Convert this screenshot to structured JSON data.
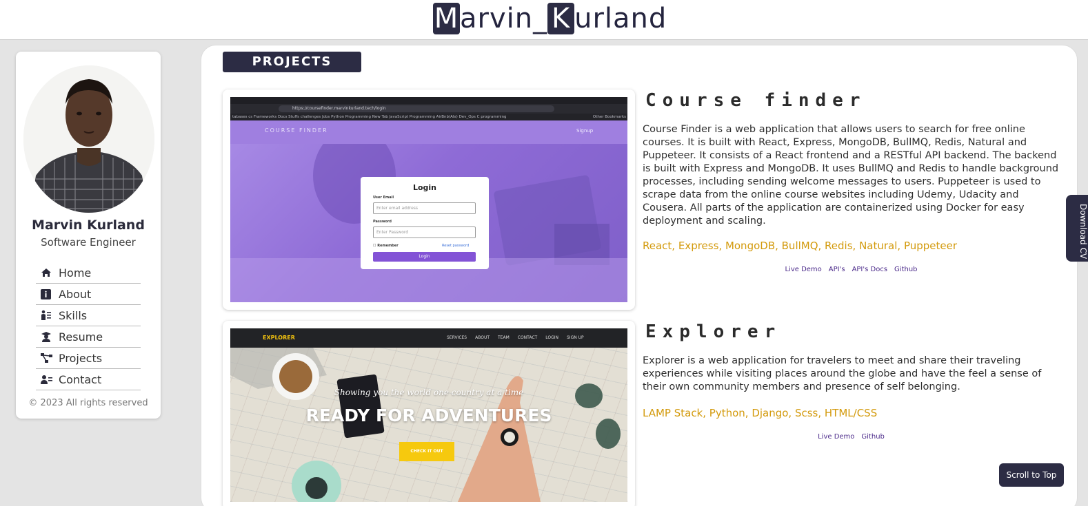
{
  "header": {
    "brand_initial_first": "M",
    "brand_rest_first": "arvin_",
    "brand_initial_last": "K",
    "brand_rest_last": "urland"
  },
  "sidebar": {
    "name": "Marvin Kurland",
    "role": "Software Engineer",
    "items": [
      {
        "label": "Home",
        "icon": "home-icon"
      },
      {
        "label": "About",
        "icon": "info-icon"
      },
      {
        "label": "Skills",
        "icon": "skills-icon"
      },
      {
        "label": "Resume",
        "icon": "graduate-icon"
      },
      {
        "label": "Projects",
        "icon": "network-icon"
      },
      {
        "label": "Contact",
        "icon": "contact-card-icon"
      }
    ],
    "copyright": "© 2023 All rights reserved"
  },
  "main": {
    "section_title": "PROJECTS",
    "projects": [
      {
        "title": "Course finder",
        "description": "Course Finder is a web application that allows users to search for free online courses. It is built with React, Express, MongoDB, BullMQ, Redis, Natural and Puppeteer. It consists of a React frontend and a RESTful API backend. The backend is built with Express and MongoDB. It uses BullMQ and Redis to handle background processes, including sending welcome messages to users. Puppeteer is used to scrape data from the online course websites including Udemy, Udacity and Cousera. All parts of the application are containerized using Docker for easy deployment and scaling.",
        "tech": "React, Express, MongoDB, BullMQ, Redis, Natural, Puppeteer",
        "links": [
          "Live Demo",
          "API's",
          "API's Docs",
          "Github"
        ],
        "screenshot": {
          "url": "https://coursefinder.marvinkurland.tech/login",
          "bookmarks": "tabases  cs  Frameworks Docs  Stuffs  challenges  Jobs  Python Programming  New Tab  JavaScript Programming  AirBnb(Alx)  Dev_Ops  C programming",
          "other_bookmarks": "Other Bookmarks",
          "logo": "COURSE FINDER",
          "signup": "Signup",
          "login_title": "Login",
          "email_label": "User Email",
          "email_placeholder": "Enter email address",
          "password_label": "Password",
          "password_placeholder": "Enter Password",
          "remember": "Remember",
          "reset": "Reset password",
          "login_button": "Login"
        }
      },
      {
        "title": "Explorer",
        "description": "Explorer is a web application for travelers to meet and share their traveling experiences while visiting places around the globe and have the feel a sense of their own community members and presence of self belonging.",
        "tech": "LAMP Stack, Python, Django, Scss, HTML/CSS",
        "links": [
          "Live Demo",
          "Github"
        ],
        "screenshot": {
          "logo": "EXPLORER",
          "nav": [
            "SERVICES",
            "ABOUT",
            "TEAM",
            "CONTACT",
            "LOGIN",
            "SIGN UP"
          ],
          "subtitle": "Showing you the world one country at a time",
          "headline": "READY FOR ADVENTURES",
          "button": "CHECK IT OUT"
        }
      }
    ]
  },
  "floating": {
    "download_cv": "Download CV",
    "scroll_top": "Scroll to Top"
  },
  "colors": {
    "accent_dark": "#2c2c44",
    "tech_gold": "#d39a0c",
    "link_purple": "#4b2a8a"
  }
}
